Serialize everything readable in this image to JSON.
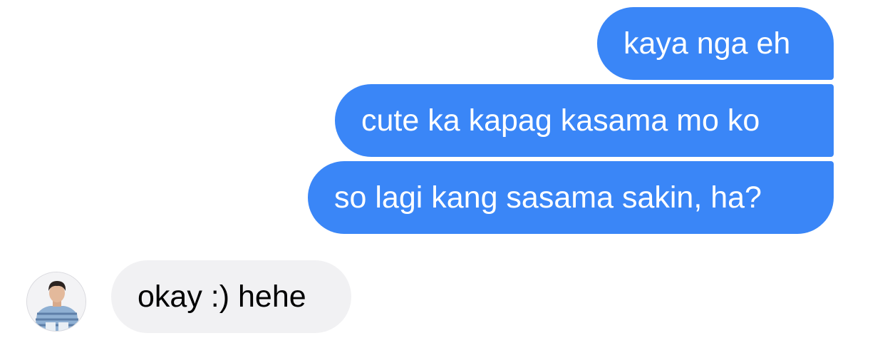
{
  "conversation": {
    "sent_messages": [
      {
        "text": "kaya nga eh"
      },
      {
        "text": "cute ka kapag kasama mo ko"
      },
      {
        "text": "so lagi kang sasama sakin, ha?"
      }
    ],
    "received_messages": [
      {
        "text": "okay :) hehe"
      }
    ]
  },
  "colors": {
    "sent_bubble": "#3a86f7",
    "sent_text": "#ffffff",
    "received_bubble": "#f1f1f3",
    "received_text": "#000000"
  },
  "icons": {
    "avatar": "contact-avatar-photo"
  }
}
